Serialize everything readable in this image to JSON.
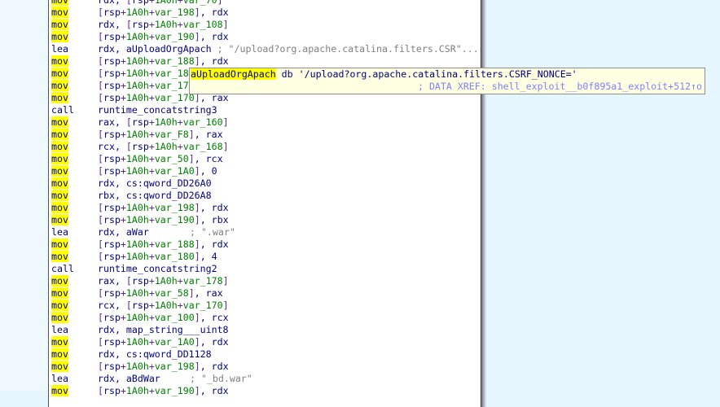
{
  "lines": [
    {
      "mn": "mov",
      "ops": "rdx, [rsp+1A0h+var_70]",
      "hl": true
    },
    {
      "mn": "mov",
      "ops": "[rsp+1A0h+var_198], rdx",
      "hl": true
    },
    {
      "mn": "mov",
      "ops": "rdx, [rsp+1A0h+var_108]",
      "hl": true
    },
    {
      "mn": "mov",
      "ops": "[rsp+1A0h+var_190], rdx",
      "hl": true
    },
    {
      "mn": "lea",
      "ops": "rdx, aUploadOrgApach",
      "comment": "; \"/upload?org.apache.catalina.filters.CSR\"...",
      "hl": false
    },
    {
      "mn": "mov",
      "ops": "[rsp+1A0h+var_188], rdx",
      "hl": true
    },
    {
      "mn": "mov",
      "ops": "[rsp+1A0h+var_18",
      "hl": true
    },
    {
      "mn": "mov",
      "ops": "[rsp+1A0h+var_17",
      "hl": true
    },
    {
      "mn": "mov",
      "ops": "[rsp+1A0h+var_170], rax",
      "hl": true
    },
    {
      "mn": "call",
      "ops": "runtime_concatstring3",
      "hl": false
    },
    {
      "mn": "mov",
      "ops": "rax, [rsp+1A0h+var_160]",
      "hl": true
    },
    {
      "mn": "mov",
      "ops": "[rsp+1A0h+var_F8], rax",
      "hl": true
    },
    {
      "mn": "mov",
      "ops": "rcx, [rsp+1A0h+var_168]",
      "hl": true
    },
    {
      "mn": "mov",
      "ops": "[rsp+1A0h+var_50], rcx",
      "hl": true
    },
    {
      "mn": "mov",
      "ops": "[rsp+1A0h+var_1A0], 0",
      "hl": true
    },
    {
      "mn": "mov",
      "ops": "rdx, cs:qword_DD26A0",
      "hl": true
    },
    {
      "mn": "mov",
      "ops": "rbx, cs:qword_DD26A8",
      "hl": true
    },
    {
      "mn": "mov",
      "ops": "[rsp+1A0h+var_198], rdx",
      "hl": true
    },
    {
      "mn": "mov",
      "ops": "[rsp+1A0h+var_190], rbx",
      "hl": true
    },
    {
      "mn": "lea",
      "ops": "rdx, aWar",
      "comment": "; \".war\"",
      "hl": false
    },
    {
      "mn": "mov",
      "ops": "[rsp+1A0h+var_188], rdx",
      "hl": true
    },
    {
      "mn": "mov",
      "ops": "[rsp+1A0h+var_180], 4",
      "hl": true
    },
    {
      "mn": "call",
      "ops": "runtime_concatstring2",
      "hl": false
    },
    {
      "mn": "mov",
      "ops": "rax, [rsp+1A0h+var_178]",
      "hl": true
    },
    {
      "mn": "mov",
      "ops": "[rsp+1A0h+var_58], rax",
      "hl": true
    },
    {
      "mn": "mov",
      "ops": "rcx, [rsp+1A0h+var_170]",
      "hl": true
    },
    {
      "mn": "mov",
      "ops": "[rsp+1A0h+var_100], rcx",
      "hl": true
    },
    {
      "mn": "lea",
      "ops": "rdx, map_string___uint8",
      "hl": false
    },
    {
      "mn": "mov",
      "ops": "[rsp+1A0h+var_1A0], rdx",
      "hl": true
    },
    {
      "mn": "mov",
      "ops": "rdx, cs:qword_DD1128",
      "hl": true
    },
    {
      "mn": "mov",
      "ops": "[rsp+1A0h+var_198], rdx",
      "hl": true
    },
    {
      "mn": "lea",
      "ops": "rdx, aBdWar",
      "comment": "; \"_bd.war\"",
      "hl": false
    },
    {
      "mn": "mov",
      "ops": "[rsp+1A0h+var_190], rdx",
      "hl": true
    }
  ],
  "tooltip": {
    "symbol": "aUploadOrgApach",
    "definition": " db '/upload?org.apache.catalina.filters.CSRF_NONCE='",
    "xref": "; DATA XREF: shell_exploit__b0f895a1_exploit+512↑o"
  },
  "colors": {
    "highlight": "#ffff00",
    "mnemonic": "#000080",
    "variable": "#008000",
    "comment": "#808080",
    "tooltip_bg": "#ffffe1"
  }
}
